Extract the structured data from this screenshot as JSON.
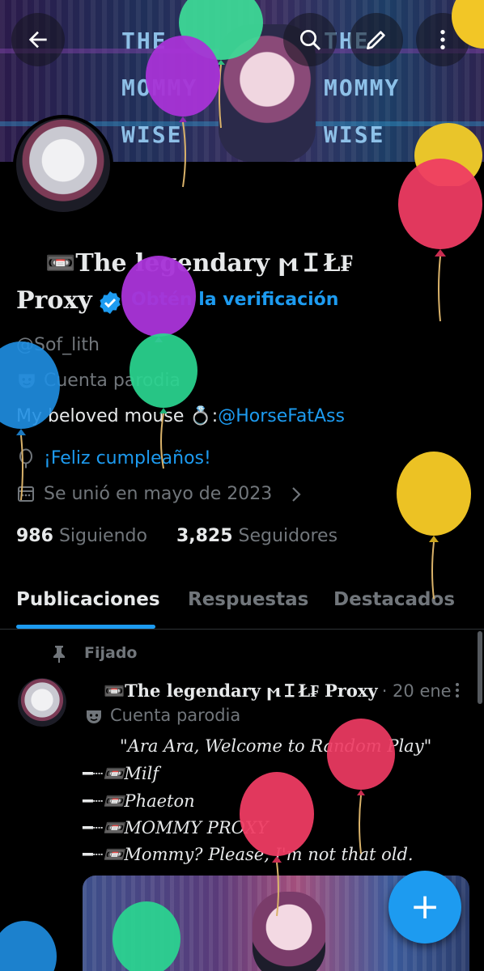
{
  "header": {
    "banner_text_left": "THE MOMMY WISE",
    "banner_text_right": "THE MOMMY WISE",
    "back_icon": "arrow-left-icon",
    "search_icon": "search-icon",
    "edit_icon": "pencil-icon",
    "more_icon": "more-vertical-icon"
  },
  "profile": {
    "name_line1": "📼The legendary ϻＩŁ₣",
    "name_line2": "Proxy",
    "verify_cta": "Obtén la verificación",
    "handle": "@Sof_lith",
    "parody_label": "Cuenta parodia",
    "bio_prefix": "My beloved mouse 💍:",
    "bio_mention": "@HorseFatAss",
    "birthday": "¡Feliz cumpleaños!",
    "joined": "Se unió en mayo de 2023",
    "following_count": "986",
    "following_label": "Siguiendo",
    "followers_count": "3,825",
    "followers_label": "Seguidores"
  },
  "tabs": [
    {
      "label": "Publicaciones",
      "active": true
    },
    {
      "label": "Respuestas",
      "active": false
    },
    {
      "label": "Destacados",
      "active": false
    }
  ],
  "post": {
    "pinned_label": "Fijado",
    "author": "📼The legendary ϻＩŁ₣ Proxy",
    "date": "· 20 ene",
    "parody_label": "Cuenta parodia",
    "lines": [
      "\"Ara Ara, Welcome to Random Play\"",
      "━┈📼Milf",
      "━┈📼Phaeton",
      "━┈📼MOMMY PROXY",
      "━┈📼Mommy? Please, I'm not that old."
    ]
  },
  "fab": {
    "label": "+"
  },
  "colors": {
    "accent": "#1d9bf0",
    "muted": "#71767b",
    "background": "#000000"
  }
}
